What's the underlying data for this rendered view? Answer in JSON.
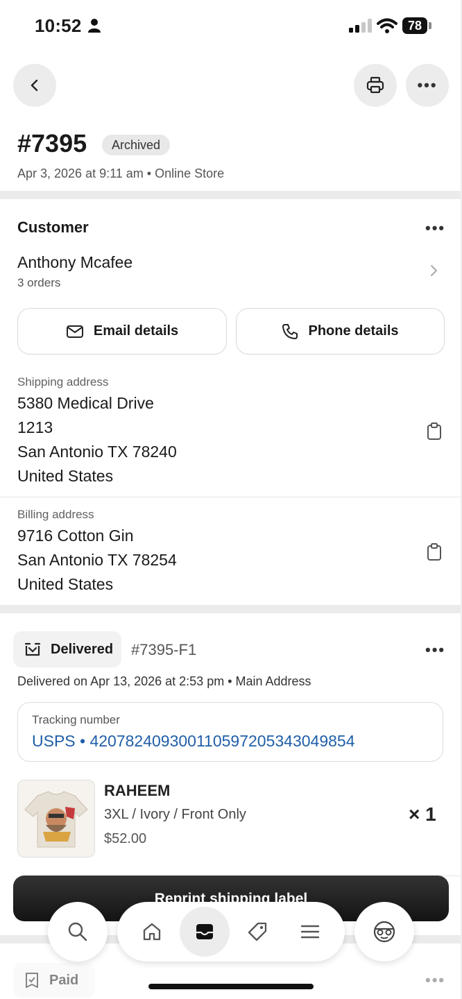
{
  "status_bar": {
    "time": "10:52",
    "battery": "78"
  },
  "order": {
    "number": "#7395",
    "badge": "Archived",
    "meta": "Apr 3, 2026 at 9:11 am • Online Store"
  },
  "customer": {
    "title": "Customer",
    "name": "Anthony Mcafee",
    "orders": "3 orders",
    "email_button": "Email details",
    "phone_button": "Phone details"
  },
  "shipping": {
    "label": "Shipping address",
    "lines": [
      "5380 Medical Drive",
      "1213",
      "San Antonio TX 78240",
      "United States"
    ]
  },
  "billing": {
    "label": "Billing address",
    "lines": [
      "9716 Cotton Gin",
      "San Antonio TX 78254",
      "United States"
    ]
  },
  "fulfillment": {
    "status": "Delivered",
    "id": "#7395-F1",
    "delivered_text": "Delivered on Apr 13, 2026 at 2:53 pm • Main Address",
    "tracking_label": "Tracking number",
    "tracking_value": "USPS • 420782409300110597205343049854"
  },
  "line_item": {
    "name": "RAHEEM",
    "variant": "3XL / Ivory / Front Only",
    "price": "$52.00",
    "qty": "× 1"
  },
  "reprint_button": "Reprint shipping label",
  "payment": {
    "status": "Paid"
  },
  "icons": {
    "back": "chevron-left-icon",
    "print": "printer-icon",
    "more": "more-horizontal-icon",
    "email": "envelope-icon",
    "phone": "phone-icon",
    "copy": "clipboard-icon",
    "delivered": "delivered-box-icon",
    "search": "search-icon",
    "home": "home-icon",
    "orders": "inbox-icon",
    "products": "tag-icon",
    "menu": "menu-icon",
    "profile": "avatar-icon"
  },
  "colors": {
    "link": "#1f5fa8",
    "badge_bg": "#e8e8e8",
    "band": "#ebebeb"
  }
}
